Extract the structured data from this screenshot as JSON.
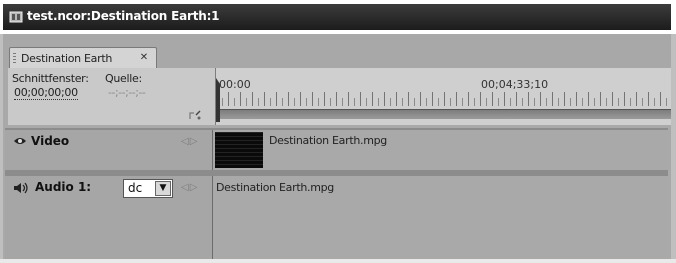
{
  "window": {
    "title": "test.ncor:Destination Earth:1"
  },
  "tab": {
    "label": "Destination Earth"
  },
  "header": {
    "source_window_label": "Schnittfenster:",
    "source_label": "Quelle:",
    "timeline_timecode": "00;00;00;00",
    "source_timecode": "--;--;--;--"
  },
  "ruler": {
    "start_time": "00:00",
    "marker_time": "00;04;33;10"
  },
  "tracks": {
    "video": {
      "name": "Video",
      "clip": "Destination Earth.mpg"
    },
    "audio": {
      "name": "Audio 1:",
      "channel": "dc",
      "clip": "Destination Earth.mpg"
    }
  },
  "icons": [
    "app-icon",
    "tab-grip-icon",
    "close-icon",
    "snap-icon",
    "playhead-icon",
    "eye-icon",
    "speaker-icon",
    "dropdown-arrow-icon",
    "keyframe-nav-icon"
  ]
}
